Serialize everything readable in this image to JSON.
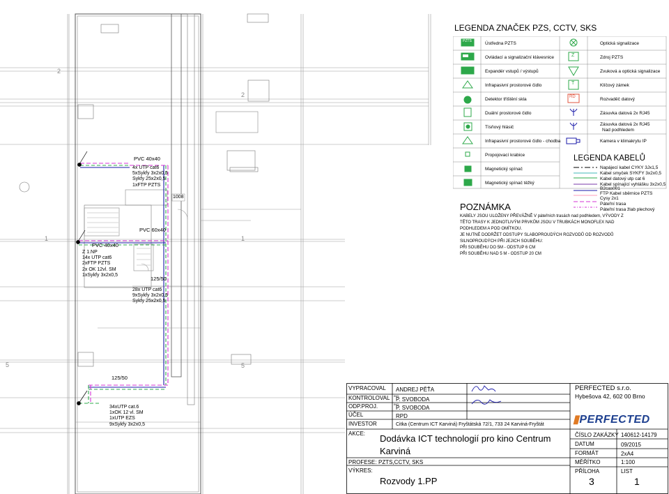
{
  "legend_devices": {
    "title": "LEGENDA ZNAČEK PZS, CCTV, SKS",
    "left": [
      {
        "label": "Ústředna PZTS",
        "icon": "control-panel-icon"
      },
      {
        "label": "Ovládací a signalizační klávesnice",
        "icon": "keypad-icon"
      },
      {
        "label": "Expandér vstupů / výstupů",
        "icon": "expander-icon"
      },
      {
        "label": "Infrapasivní prostorové čidlo",
        "icon": "pir-sensor-icon"
      },
      {
        "label": "Detektor tříštění skla",
        "icon": "glass-break-icon"
      },
      {
        "label": "Duální prostorové čidlo",
        "icon": "dual-sensor-icon"
      },
      {
        "label": "Tísňový hlásič",
        "icon": "panic-button-icon"
      },
      {
        "label": "Infrapasivní prostorové čidlo - chodba",
        "icon": "pir-corridor-icon"
      },
      {
        "label": "Propojovací krabice",
        "icon": "junction-box-icon"
      },
      {
        "label": "Magnetický spínač",
        "icon": "magnetic-switch-icon"
      },
      {
        "label": "Magnetický spínač těžký",
        "icon": "heavy-magnetic-switch-icon"
      }
    ],
    "right": [
      {
        "label": "Optická signalizace",
        "icon": "optical-signal-icon"
      },
      {
        "label": "Zdroj PZTS",
        "icon": "power-supply-icon"
      },
      {
        "label": "Zvuková a optická signalizace",
        "icon": "siren-icon"
      },
      {
        "label": "Klíčový zámek",
        "icon": "key-lock-icon"
      },
      {
        "label": "Rozvaděč datový",
        "icon": "data-rack-icon"
      },
      {
        "label": "Zásuvka datová 2x RJ45",
        "icon": "data-socket-icon"
      },
      {
        "label": "Zásuvka datová 2x RJ45",
        "label2": "Nad podhledem",
        "icon": "data-socket-ceiling-icon"
      },
      {
        "label": "Kamera v klimakrytu IP",
        "icon": "camera-icon"
      }
    ],
    "symbol_texts": {
      "pzts": "PZTS",
      "z": "Z",
      "t": "T",
      "rd": "RD"
    }
  },
  "legend_cables": {
    "title": "LEGENDA KABELŮ",
    "items": [
      {
        "label": "Napájecí kabel CYKY 3Jx1,5",
        "color": "#000000",
        "dash": "8 3 2 3"
      },
      {
        "label": "Kabel smyček  SYKFY 3x2x0,5",
        "color": "#3fb7b7",
        "dash": "none"
      },
      {
        "label": "Kabel datový utp cat 6",
        "color": "#2da84a",
        "dash": "none"
      },
      {
        "label": "Kabel spínající vyhlášku 3x2x0,5",
        "label2": "B2cas001",
        "color": "#7a3aa8",
        "dash": "none"
      },
      {
        "label": "FTP Kabel sběrnice PZTS",
        "color": "#1a1aa8",
        "dash": "none"
      },
      {
        "label": "Cysy 2x1",
        "color": "#ff9db8",
        "dash": "none"
      },
      {
        "label": "Páteřní trasa",
        "color": "#d433d4",
        "dash": "6 3"
      },
      {
        "label": "Páteřní trasa  žlab plechový",
        "color": "#d433d4",
        "dash": "3 2 1 2"
      }
    ]
  },
  "notes": {
    "title": "POZNÁMKA",
    "lines": [
      "KABELY JSOU ULOŽENY PŘEVÁŽNĚ V  páteřních trasách nad podhledem, VÝVODY Z",
      "TĚTO TRASY K JEDNOTLIVÝM PRVKŮM JSOU V TRUBKÁCH MONOFLEX NAD",
      "PODHLEDEM A POD OMÍTKOU.",
      "JE NUTNÉ DODRŽET ODSTUPY SLABOPROUDÝCH ROZVODŮ OD ROZVODŮ",
      "SILNOPROUDÝCH PŘI JEJICH SOUBĚHU:",
      "PŘI SOUBĚHU DO 5M     - ODSTUP 6 CM",
      "PŘI SOUBĚHU NAD 5 M - ODSTUP 20 CM"
    ]
  },
  "plan": {
    "pvc_top": "PVC 40x40",
    "cables_top": "4x UTP cat6\n5xSykfy 3x2x0,5\nSykfy 25x2x0,5\n1xFTP PZTS",
    "label_1008": "1008",
    "pvc_60": "PVC 60x40",
    "pvc_left": "PVC 40x40",
    "floor_block": "Z 1.NP\n14x UTP cat6\n2xFTP PZTS\n2x OK 12vl. SM\n1xSykfy 3x2x0,5",
    "tray_mid": "125/50",
    "cables_mid": "28x UTP cat6\n9xSykfy 3x2x0,5\nSykfy 25x2x0,5",
    "tray_bottom": "125/50",
    "cables_bottom": "34xUTP cat.6\n1xOK 12 vl. SM\n1xUTP EZS\n9xSykfy 3x2x0,5",
    "grid_labels": {
      "left_1": "1",
      "mid_1": "1",
      "left_5": "5",
      "mid_5": "5",
      "left_2": "2",
      "mid_2": "2"
    }
  },
  "title_block": {
    "vypracoval_label": "VYPRACOVAL",
    "vypracoval_value": "ANDREJ PĚŤA",
    "kontroloval_label": "KONTROLOVAL",
    "kontroloval_prefix": "ING.",
    "kontroloval_value": "P. SVOBODA",
    "odp_label": "ODP.PROJ.",
    "odp_prefix": "ING.",
    "odp_value": "P. SVOBODA",
    "ucel_label": "ÚČEL",
    "ucel_value": "RPD",
    "investor_label": "INVESTOR",
    "investor_value": "Citka (Centrum ICT Karviná) Fryštátská 72/1, 733 24  Karviná-Fryštát",
    "akce_label": "AKCE:",
    "akce_value": "Dodávka ICT technologií pro kino Centrum\nKarviná",
    "profese_label": "PROFESE:",
    "profese_value": "PZTS,CCTV, SKS",
    "vykres_label": "VÝKRES:",
    "vykres_value": "Rozvody 1.PP",
    "company_name": "PERFECTED s.r.o.",
    "company_address": "Hybešova 42, 602 00 Brno",
    "logo_text": "PERFECTED",
    "cislo_label": "ČÍSLO ZAKÁZKY",
    "cislo_value": "140612-14179",
    "datum_label": "DATUM",
    "datum_value": "09/2015",
    "format_label": "FORMÁT",
    "format_value": "2xA4",
    "meritko_label": "MĚŘÍTKO",
    "meritko_value": "1:100",
    "priloha_label": "PŘÍLOHA",
    "priloha_value": "3",
    "list_label": "LIST",
    "list_value": "1"
  }
}
